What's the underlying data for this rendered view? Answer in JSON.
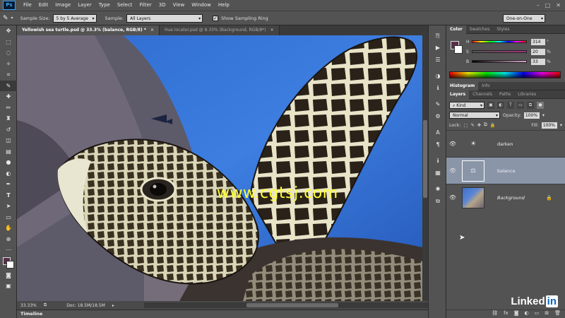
{
  "app": {
    "logo": "Ps"
  },
  "menu": [
    "File",
    "Edit",
    "Image",
    "Layer",
    "Type",
    "Select",
    "Filter",
    "3D",
    "View",
    "Window",
    "Help"
  ],
  "window_controls": [
    "–",
    "□",
    "✕"
  ],
  "options_bar": {
    "sample_size_label": "Sample Size:",
    "sample_size_value": "5 by 5 Average",
    "sample_label": "Sample:",
    "sample_value": "All Layers",
    "show_ring_label": "Show Sampling Ring",
    "workspace": "One-on-One"
  },
  "tabs": [
    {
      "label": "Yellowish sea turtle.psd @ 33.3% (balance, RGB/8) *",
      "active": true
    },
    {
      "label": "Hue locator.psd @ 8.33% (Background, RGB/8*)",
      "active": false
    }
  ],
  "canvas": {
    "watermark": "www.cgtsj.com"
  },
  "status": {
    "zoom": "33.33%",
    "doc": "Doc: 18.5M/18.5M"
  },
  "timeline_label": "Timeline",
  "color_panel": {
    "tabs": [
      "Color",
      "Swatches",
      "Styles"
    ],
    "channels": [
      {
        "label": "H",
        "value": "314",
        "unit": "°"
      },
      {
        "label": "S",
        "value": "20",
        "unit": "%"
      },
      {
        "label": "B",
        "value": "33",
        "unit": "%"
      }
    ],
    "foreground": "#5a2e4b",
    "background": "#ffffff"
  },
  "histogram_tabs": [
    "Histogram",
    "Info"
  ],
  "layers_panel": {
    "tabs": [
      "Layers",
      "Channels",
      "Paths",
      "Libraries"
    ],
    "kind_label": "Kind",
    "blend_mode": "Normal",
    "opacity_label": "Opacity:",
    "opacity_value": "100%",
    "lock_label": "Lock:",
    "fill_label": "Fill:",
    "fill_value": "100%",
    "layers": [
      {
        "name": "darken",
        "selected": false,
        "icon": "☀"
      },
      {
        "name": "balance",
        "selected": true,
        "icon": "⚖"
      },
      {
        "name": "Background",
        "selected": false,
        "icon": ""
      }
    ]
  },
  "branding": {
    "name": "Linked",
    "in": "in"
  }
}
